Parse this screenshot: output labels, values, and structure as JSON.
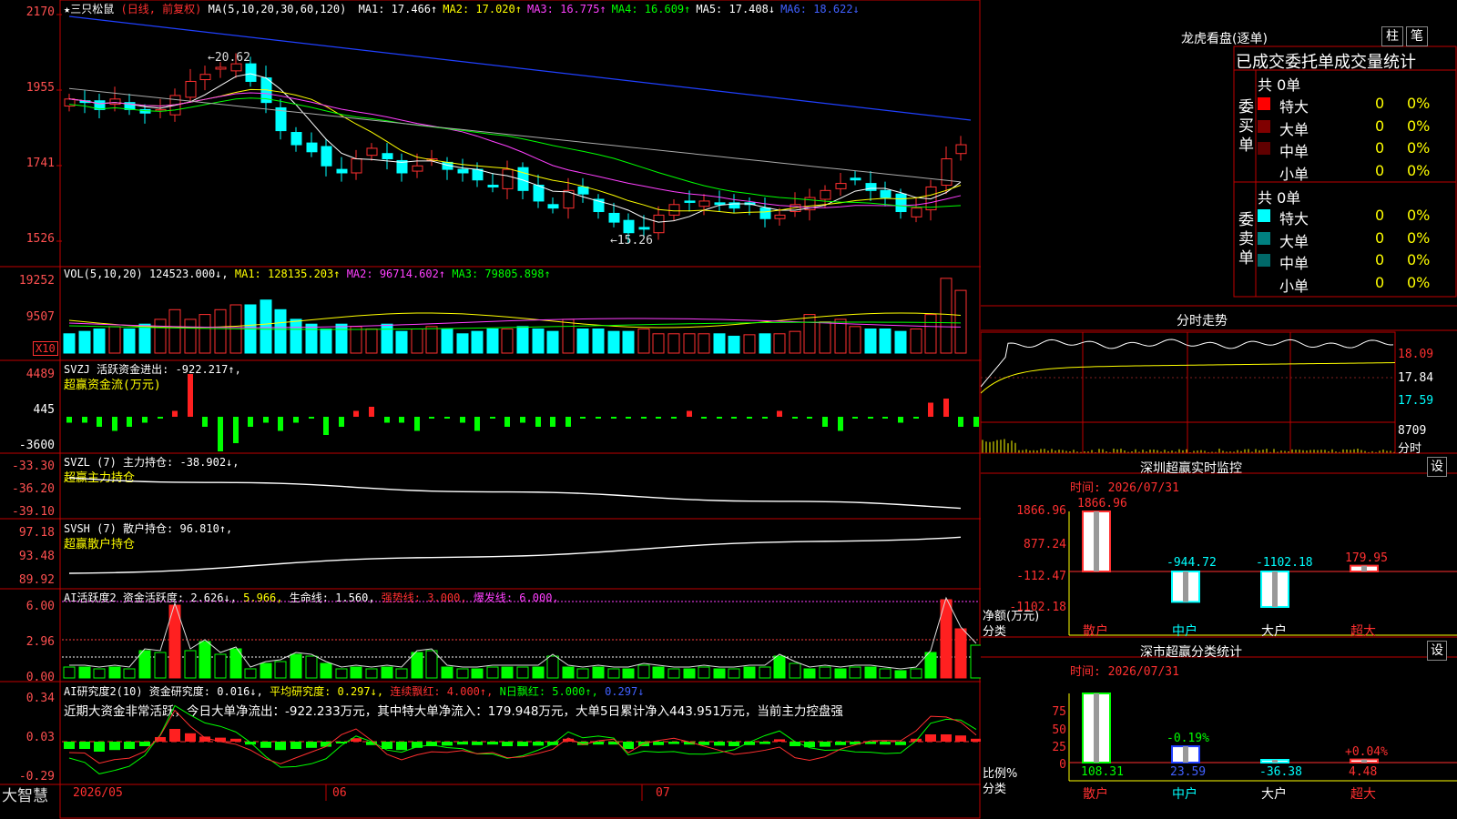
{
  "stock": {
    "name": "★三只松鼠",
    "mode": "(日线, 前复权)",
    "ma_header": "MA(5,10,20,30,60,120)",
    "ma_values": [
      {
        "label": "MA1:",
        "value": "17.466↑",
        "color": "#ffffff"
      },
      {
        "label": "MA2:",
        "value": "17.020↑",
        "color": "#ffff00"
      },
      {
        "label": "MA3:",
        "value": "16.775↑",
        "color": "#ff40ff"
      },
      {
        "label": "MA4:",
        "value": "16.609↑",
        "color": "#00ff00"
      },
      {
        "label": "MA5:",
        "value": "17.408↓",
        "color": "#ffffff"
      },
      {
        "label": "MA6:",
        "value": "18.622↓",
        "color": "#4060ff"
      }
    ],
    "high_mark": "20.62",
    "low_mark": "15.26",
    "price_ticks": [
      "2170",
      "1955",
      "1741",
      "1526"
    ]
  },
  "vol_panel": {
    "header": "VOL(5,10,20)",
    "vol_value": "124523.000↓,",
    "ma1": "MA1: 128135.203↑",
    "ma2": "MA2: 96714.602↑",
    "ma3": "MA3: 79805.898↑",
    "ticks": [
      "19252",
      "9507"
    ],
    "unit": "X10"
  },
  "svzj_panel": {
    "header": "SVZJ  活跃资金进出: -922.217↑,",
    "sub": "超赢资金流(万元)",
    "ticks": [
      "4489",
      "445",
      "-3600"
    ]
  },
  "svzl_panel": {
    "header": "SVZL (7) 主力持仓: -38.902↓,",
    "sub": "超赢主力持仓",
    "ticks": [
      "-33.30",
      "-36.20",
      "-39.10"
    ]
  },
  "svsh_panel": {
    "header": "SVSH (7) 散户持仓: 96.810↑,",
    "sub": "超赢散户持仓",
    "ticks": [
      "97.18",
      "93.48",
      "89.92"
    ]
  },
  "ai_active_panel": {
    "header_a": "AI活跃度2 资金活跃度: 2.626↓,",
    "header_b": "5.966,",
    "header_c": "生命线: 1.560,",
    "header_d": "强势线: 3.000,",
    "header_e": "爆发线: 6.000,",
    "ticks": [
      "6.00",
      "2.96",
      "0.00"
    ]
  },
  "ai_research_panel": {
    "header_a": "AI研究度2(10) 资金研究度: 0.016↓,",
    "header_b": "平均研究度: 0.297↓,",
    "header_c": "连续飘红: 4.000↑,",
    "header_d": "N日飘红: 5.000↑,",
    "header_e": "0.297↓",
    "summary": "近期大资金非常活跃，今日大单净流出：-922.233万元，其中特大单净流入：179.948万元，大单5日累计净入443.951万元，当前主力控盘强",
    "ticks": [
      "0.34",
      "0.03",
      "-0.29"
    ]
  },
  "date_axis": {
    "brand": "大智慧",
    "labels": [
      "2026/05",
      "06",
      "07"
    ]
  },
  "longhu": {
    "title": "龙虎看盘(逐单)",
    "btn_bar": "柱",
    "btn_tick": "笔",
    "subtitle": "已成交委托单成交量统计",
    "buy_label": "委买单",
    "sell_label": "委卖单",
    "buy_total": "共 0单",
    "sell_total": "共 0单",
    "buy_rows": [
      {
        "name": "特大",
        "count": "0",
        "pct": "0%",
        "color": "#ff0000"
      },
      {
        "name": "大单",
        "count": "0",
        "pct": "0%",
        "color": "#800000"
      },
      {
        "name": "中单",
        "count": "0",
        "pct": "0%",
        "color": "#600000"
      },
      {
        "name": "小单",
        "count": "0",
        "pct": "0%",
        "color": "#000000"
      }
    ],
    "sell_rows": [
      {
        "name": "特大",
        "count": "0",
        "pct": "0%",
        "color": "#00ffff"
      },
      {
        "name": "大单",
        "count": "0",
        "pct": "0%",
        "color": "#008080"
      },
      {
        "name": "中单",
        "count": "0",
        "pct": "0%",
        "color": "#006868"
      },
      {
        "name": "小单",
        "count": "0",
        "pct": "0%",
        "color": "#000000"
      }
    ]
  },
  "intraday": {
    "title": "分时走势",
    "ticks": [
      "18.09",
      "17.84",
      "17.59"
    ],
    "vol_tick": "8709",
    "unit": "分时"
  },
  "monitor": {
    "title": "深圳超赢实时监控",
    "setting": "设",
    "time": "时间: 2026/07/31",
    "ticks": [
      "1866.96",
      "877.24",
      "-112.47",
      "-1102.18"
    ],
    "y_label": "净额(万元)",
    "x_label": "分类",
    "bars": [
      {
        "name": "散户",
        "value": 1866.96,
        "label": "1866.96"
      },
      {
        "name": "中户",
        "value": -944.72,
        "label": "-944.72"
      },
      {
        "name": "大户",
        "value": -1102.18,
        "label": "-1102.18"
      },
      {
        "name": "超大",
        "value": 179.95,
        "label": "179.95"
      }
    ]
  },
  "classify": {
    "title": "深市超赢分类统计",
    "setting": "设",
    "time": "时间: 2026/07/31",
    "ticks": [
      "75",
      "50",
      "25",
      "0"
    ],
    "y_label": "比例%",
    "x_label": "分类",
    "bars": [
      {
        "name": "散户",
        "value": 108.31,
        "label": "108.31",
        "delta": ""
      },
      {
        "name": "中户",
        "value": 23.59,
        "label": "23.59",
        "delta": "-0.19%"
      },
      {
        "name": "大户",
        "value": -36.38,
        "label": "-36.38",
        "delta": ""
      },
      {
        "name": "超大",
        "value": 4.48,
        "label": "4.48",
        "delta": "+0.04%"
      }
    ]
  }
}
